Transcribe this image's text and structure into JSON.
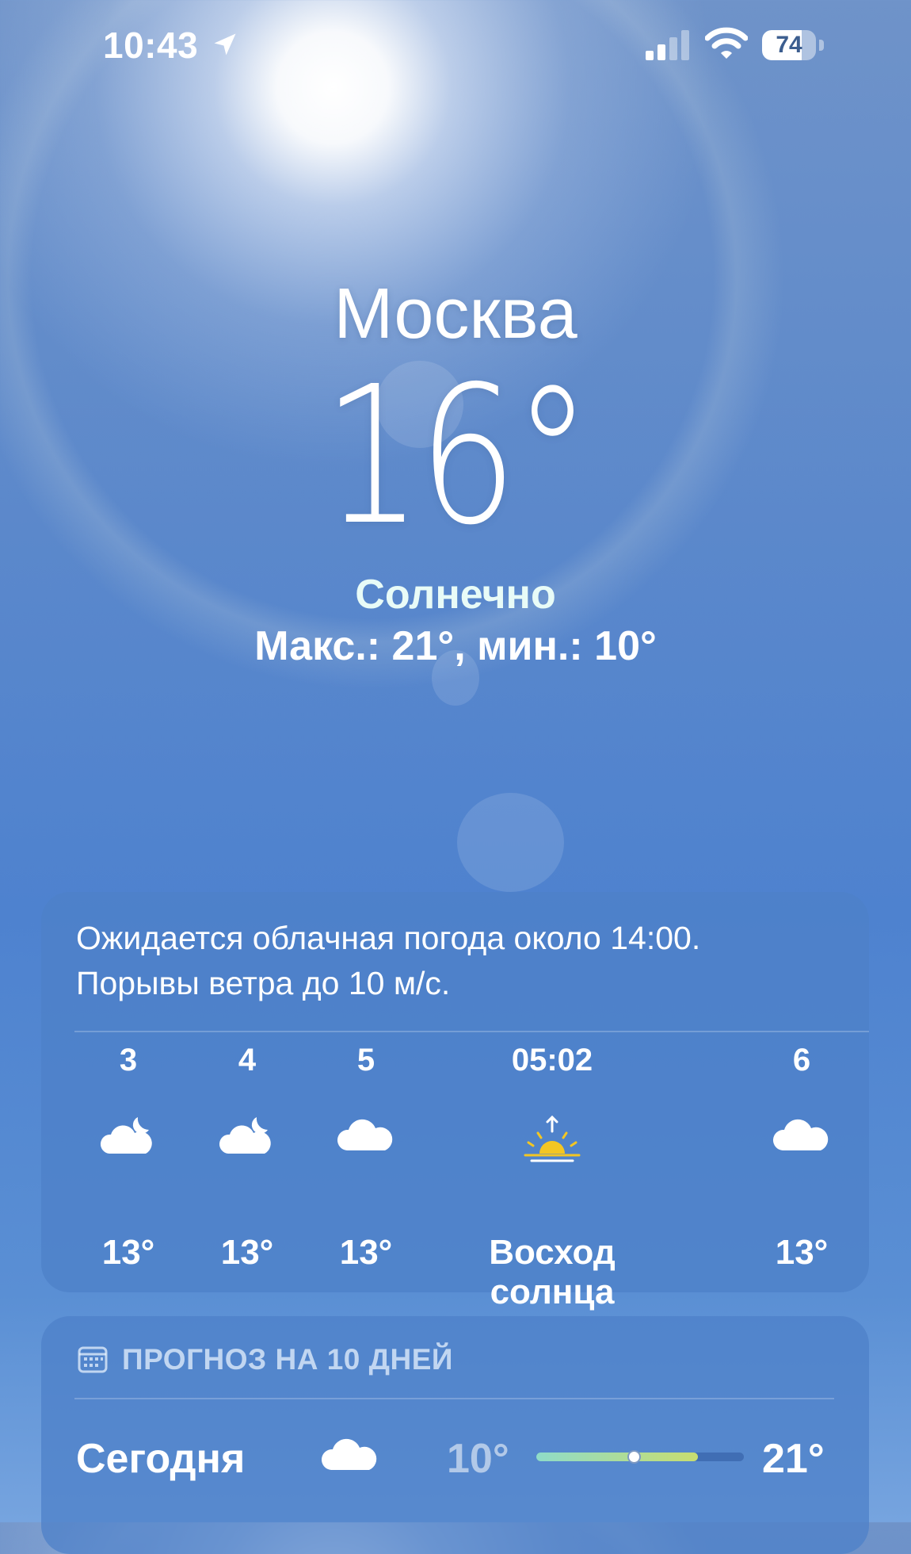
{
  "status_bar": {
    "time": "10:43",
    "battery_percent": "74",
    "battery_level": 0.74,
    "icons": [
      "location-arrow-icon",
      "cellular-signal-icon",
      "wifi-icon",
      "battery-icon"
    ]
  },
  "current": {
    "city": "Москва",
    "temperature": "16°",
    "condition": "Солнечно",
    "high_low": "Макс.: 21°, мин.: 10°"
  },
  "hourly": {
    "summary_line1": "Ожидается облачная погода около 14:00.",
    "summary_line2": "Порывы ветра до 10 м/с.",
    "items": [
      {
        "label": "3",
        "icon": "partly-cloudy-night-icon",
        "temp": "13°"
      },
      {
        "label": "4",
        "icon": "partly-cloudy-night-icon",
        "temp": "13°"
      },
      {
        "label": "5",
        "icon": "cloud-icon",
        "temp": "13°"
      },
      {
        "label": "05:02",
        "icon": "sunrise-icon",
        "temp": "Восход солнца"
      },
      {
        "label": "6",
        "icon": "cloud-icon",
        "temp": "13°"
      }
    ]
  },
  "forecast": {
    "title": "ПРОГНОЗ НА 10 ДНЕЙ",
    "title_icon": "calendar-icon",
    "days": [
      {
        "label": "Сегодня",
        "icon": "cloud-icon",
        "min": "10°",
        "max": "21°",
        "range_start": 0.0,
        "range_end": 0.78,
        "current_marker": 0.47
      }
    ]
  },
  "colors": {
    "sky": "#5b88cb",
    "card": "#4e80c8",
    "condition_text": "#e8fbf7",
    "sun_yellow": "#f3c623"
  }
}
